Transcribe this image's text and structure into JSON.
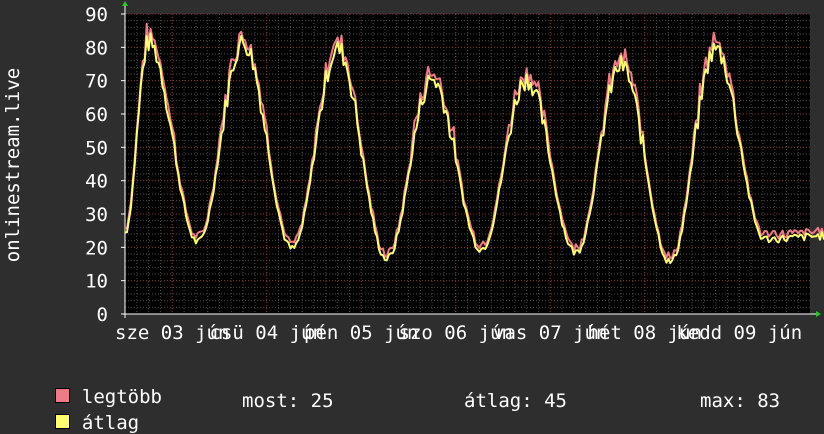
{
  "chart_data": {
    "type": "line",
    "ylabel": "onlinestream.live",
    "ylim": [
      0,
      90
    ],
    "yticks": [
      0,
      10,
      20,
      30,
      40,
      50,
      60,
      70,
      80,
      90
    ],
    "xtick_labels": [
      "sze 03 jún",
      "csü 04 jún",
      "pén 05 jún",
      "szo 06 jún",
      "vas 07 jún",
      "hét 08 jún",
      "kedd 09 jún"
    ],
    "x_range_days": [
      0,
      7.5
    ],
    "grid": true,
    "background": "#000000",
    "days": [
      {
        "max": 83,
        "min": 23
      },
      {
        "max": 83,
        "min": 21
      },
      {
        "max": 81,
        "min": 18
      },
      {
        "max": 72,
        "min": 21
      },
      {
        "max": 72,
        "min": 20
      },
      {
        "max": 76,
        "min": 17
      },
      {
        "max": 81,
        "min": 24
      }
    ],
    "end_value": 25,
    "series": [
      {
        "name": "legtöbb",
        "color": "#f07a86"
      },
      {
        "name": "átlag",
        "color": "#ffff70"
      }
    ]
  },
  "legend": {
    "max_label": "legtöbb",
    "avg_label": "átlag",
    "now_text": "most: 25",
    "avg_text": "átlag: 45",
    "max_text": "max: 83"
  }
}
